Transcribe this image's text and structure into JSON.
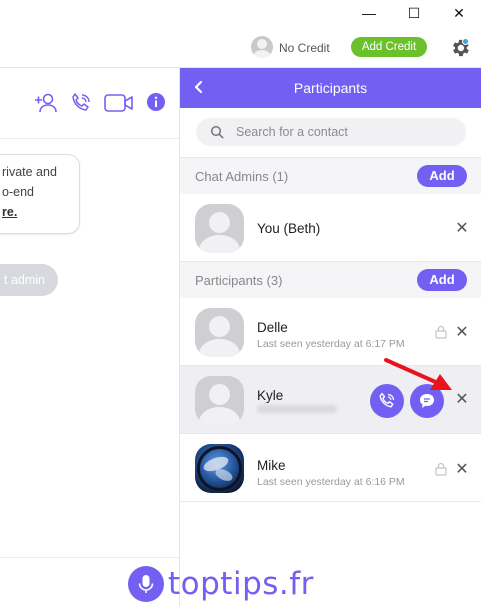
{
  "window": {
    "minimize": "—",
    "maximize": "☐",
    "close": "✕"
  },
  "topbar": {
    "no_credit": "No Credit",
    "add_credit": "Add Credit",
    "icons": [
      "avatar-placeholder",
      "gear-icon"
    ]
  },
  "chat": {
    "header_icons": [
      "add-participant-icon",
      "audio-call-icon",
      "video-call-icon",
      "info-icon"
    ],
    "notice_lines": [
      "rivate and",
      "o-end",
      "re."
    ],
    "admin_pill": "t admin"
  },
  "participants": {
    "title": "Participants",
    "back": "‹",
    "search_placeholder": "Search for a contact",
    "admins_section": {
      "label": "Chat Admins (1)",
      "add_label": "Add"
    },
    "admins": [
      {
        "name": "You (Beth)"
      }
    ],
    "members_section": {
      "label": "Participants (3)",
      "add_label": "Add"
    },
    "members": [
      {
        "name": "Delle",
        "last_seen": "Last seen yesterday at 6:17 PM"
      },
      {
        "name": "Kyle",
        "last_seen": ""
      },
      {
        "name": "Mike",
        "last_seen": "Last seen yesterday at 6:16 PM"
      }
    ]
  },
  "watermark": "toptips.fr",
  "colors": {
    "accent": "#7360f2",
    "credit_green": "#6bc12b",
    "annotation_red": "#e8141c"
  }
}
